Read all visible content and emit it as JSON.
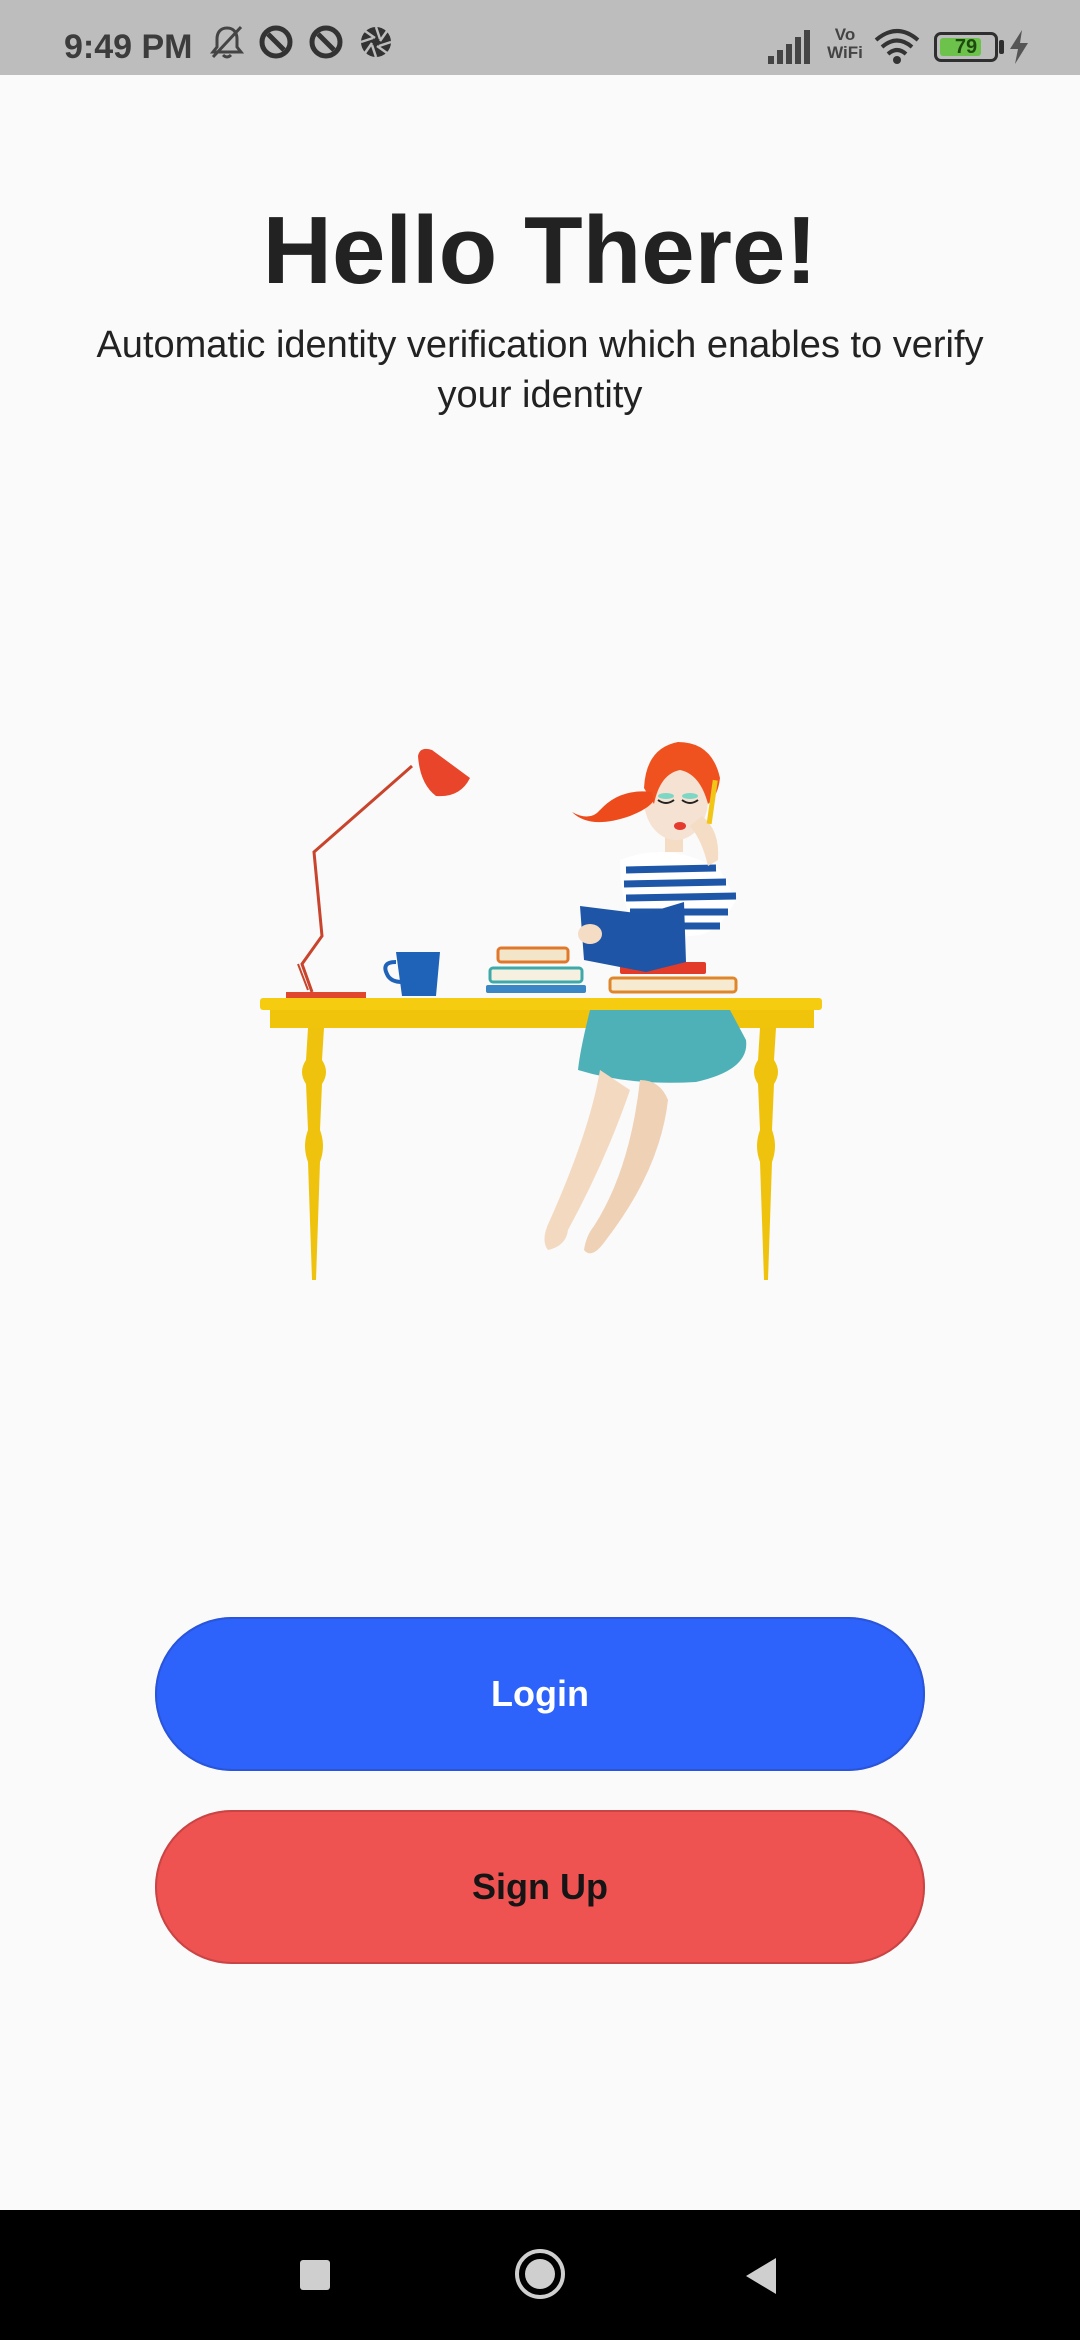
{
  "status_bar": {
    "time": "9:49 PM",
    "battery_level": "79",
    "battery_fraction": 0.79,
    "icons": [
      "bell-muted-icon",
      "sync-icon",
      "sync-icon",
      "shutter-icon",
      "signal-icon",
      "vowifi-icon",
      "wifi-icon",
      "battery-icon",
      "charging-icon"
    ],
    "vowifi_top": "Vo",
    "vowifi_bottom": "WiFi"
  },
  "header": {
    "title": "Hello There!",
    "subtitle": "Automatic identity verification which enables to verify your identity"
  },
  "actions": {
    "login_label": "Login",
    "signup_label": "Sign Up"
  },
  "colors": {
    "login_button": "#2d62fb",
    "signup_button": "#ee5352",
    "background": "#fafafa",
    "status_bar": "#bdbdbd"
  },
  "nav_bar": {
    "icons": [
      "recents-square-icon",
      "home-circle-icon",
      "back-triangle-icon"
    ]
  }
}
